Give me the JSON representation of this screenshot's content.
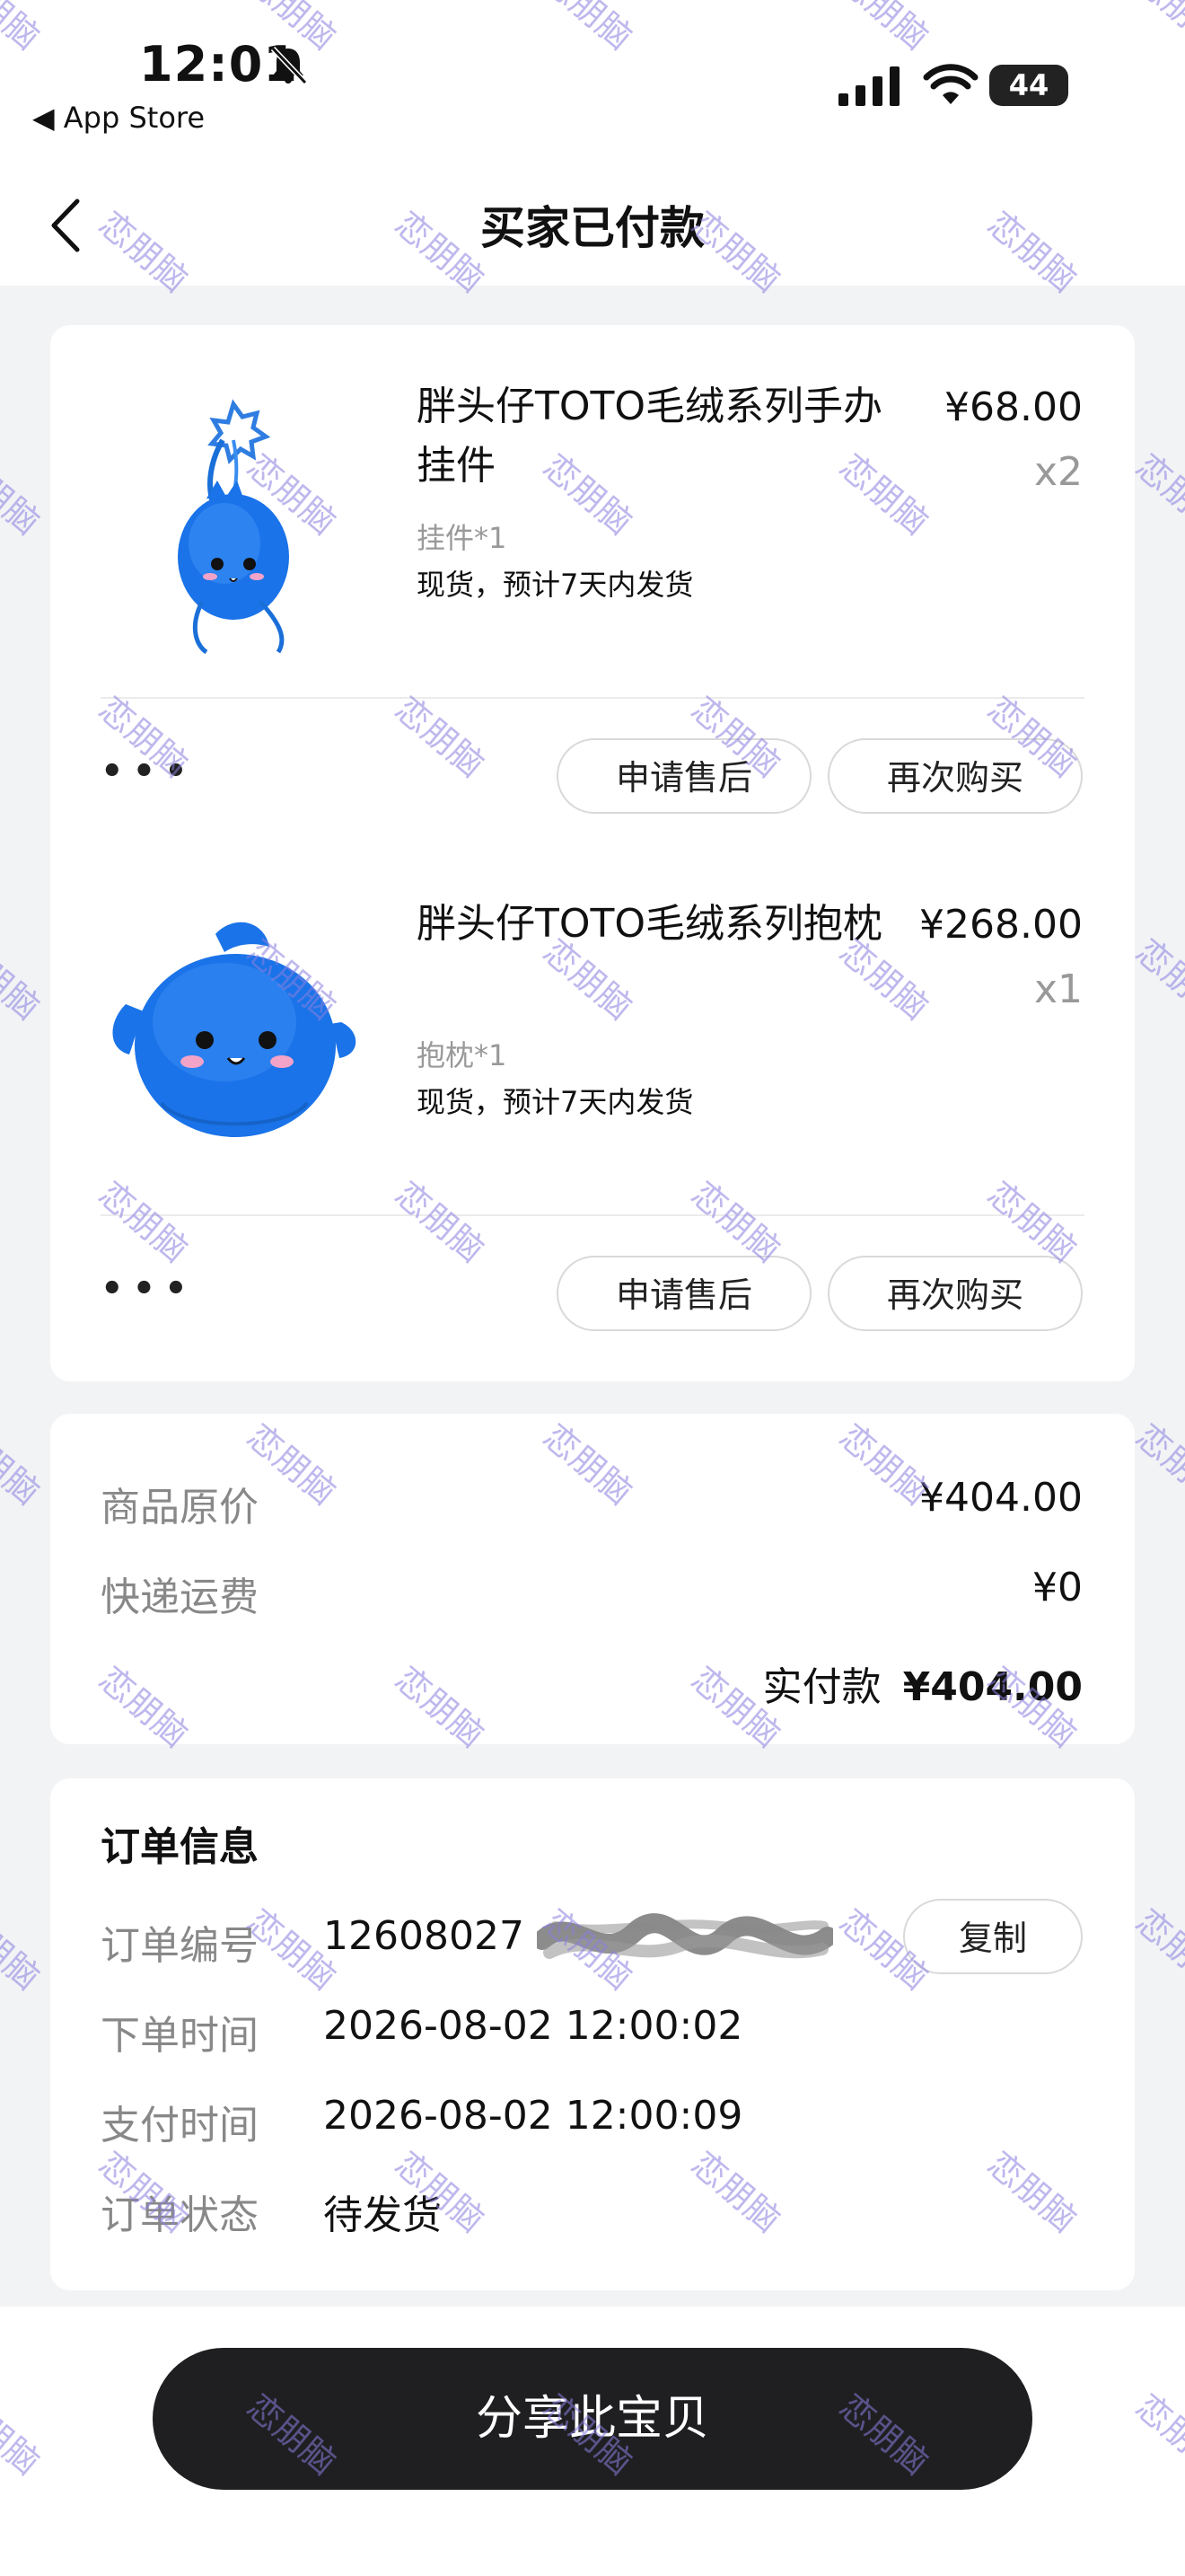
{
  "status_bar": {
    "time": "12:01",
    "back_app": "◀ App Store",
    "battery": "44",
    "icons": [
      "bell-slash-icon",
      "signal-icon",
      "wifi-icon",
      "battery-icon"
    ]
  },
  "nav": {
    "title": "买家已付款",
    "back_icon": "chevron-left-icon"
  },
  "products": [
    {
      "name": "胖头仔TOTO毛绒系列手办挂件",
      "price": "¥68.00",
      "qty": "x2",
      "spec": "挂件*1",
      "shipping": "现货，预计7天内发货",
      "more": "•••",
      "after_sale": "申请售后",
      "buy_again": "再次购买"
    },
    {
      "name": "胖头仔TOTO毛绒系列抱枕",
      "price": "¥268.00",
      "qty": "x1",
      "spec": "抱枕*1",
      "shipping": "现货，预计7天内发货",
      "more": "•••",
      "after_sale": "申请售后",
      "buy_again": "再次购买"
    }
  ],
  "prices": {
    "original_label": "商品原价",
    "original_value": "¥404.00",
    "shipping_label": "快递运费",
    "shipping_value": "¥0",
    "paid_label": "实付款",
    "paid_value": "¥404.00"
  },
  "order": {
    "title": "订单信息",
    "number_label": "订单编号",
    "number_value": "12608027",
    "copy_label": "复制",
    "created_label": "下单时间",
    "created_value": "2026-08-02 12:00:02",
    "paid_time_label": "支付时间",
    "paid_time_value": "2026-08-02 12:00:09",
    "status_label": "订单状态",
    "status_value": "待发货"
  },
  "share_button": "分享此宝贝",
  "watermark": "恋朋脑",
  "colors": {
    "accent_dark": "#1f1f21",
    "page_bg": "#f2f3f5",
    "watermark": "#8a7fe0",
    "plush_blue": "#1a73e8"
  }
}
